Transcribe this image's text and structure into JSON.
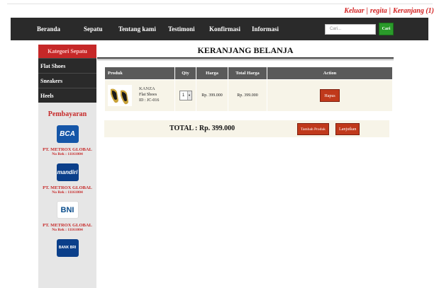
{
  "top_links": {
    "logout": "Keluar",
    "register": "regita",
    "cart": "Keranjang (1)"
  },
  "nav": {
    "items": [
      "Beranda",
      "Sepatu",
      "Tentang kami",
      "Testimoni",
      "Konfirmasi",
      "Informasi"
    ],
    "search_placeholder": "Cari...",
    "search_button": "Cari"
  },
  "sidebar": {
    "category_title": "Kategori Sepatu",
    "categories": [
      "Flat Shoes",
      "Sneakers",
      "Heels"
    ],
    "payment_title": "Pembayaran",
    "banks": [
      {
        "logo": "BCA",
        "account_name": "PT. METROX GLOBAL",
        "account_no": "No Rek : 11161004"
      },
      {
        "logo": "mandiri",
        "account_name": "PT. METROX GLOBAL",
        "account_no": "No Rek : 11161004"
      },
      {
        "logo": "BNI",
        "account_name": "PT. METROX GLOBAL",
        "account_no": "No Rek : 11161004"
      },
      {
        "logo": "BANK BRI"
      }
    ]
  },
  "cart": {
    "title": "KERANJANG BELANJA",
    "columns": [
      "Produk",
      "Qty",
      "Harga",
      "Total Harga",
      "Action"
    ],
    "items": [
      {
        "brand": "KANZA",
        "name": "Flat Shoes",
        "id": "ID : JC-016",
        "qty": "1",
        "price": "Rp. 399.000",
        "total": "Rp. 399.000",
        "action": "Hapus"
      }
    ],
    "total_label": "TOTAL : Rp. 399.000",
    "add_button": "Tambah Produk",
    "continue_button": "Lanjutkan"
  },
  "colors": {
    "brand_red": "#c62828",
    "nav_bg": "#2a2a2a",
    "button_red": "#c0391b",
    "search_green": "#2a9a2a"
  }
}
